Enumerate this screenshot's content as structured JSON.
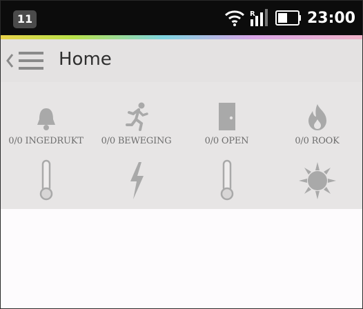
{
  "statusbar": {
    "notification_count": "11",
    "time": "23:00",
    "icons": [
      "wifi-icon",
      "signal-icon",
      "battery-icon"
    ]
  },
  "actionbar": {
    "title": "Home",
    "icons": [
      "back-chevron-icon",
      "menu-icon"
    ]
  },
  "sensors": [
    {
      "label": "0/0 INGEDRUKT",
      "icon": "bell-icon"
    },
    {
      "label": "0/0 BEWEGING",
      "icon": "running-person-icon"
    },
    {
      "label": "0/0 OPEN",
      "icon": "door-icon"
    },
    {
      "label": "0/0 ROOK",
      "icon": "flame-icon"
    }
  ],
  "sensors_row2": [
    {
      "icon": "thermometer-icon"
    },
    {
      "icon": "lightning-icon"
    },
    {
      "icon": "thermometer-icon"
    },
    {
      "icon": "sun-icon"
    }
  ],
  "colors": {
    "statusbar_bg": "#0c0c0c",
    "actionbar_bg": "#e4e2e2",
    "panel_bg": "#e7e5e5",
    "icon_gray": "#a9a9a9",
    "title_text": "#2f2f2f"
  }
}
